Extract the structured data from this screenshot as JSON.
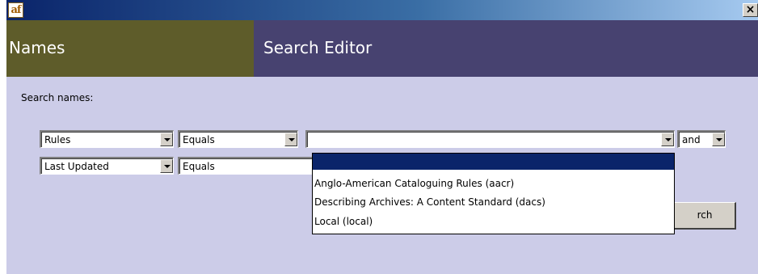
{
  "window": {
    "app_icon_text": "af",
    "close_glyph": "×"
  },
  "header": {
    "left_title": "Names",
    "right_title": "Search Editor"
  },
  "search": {
    "label": "Search names:",
    "rows": [
      {
        "field": "Rules",
        "operator": "Equals",
        "value": "",
        "conjunction": "and"
      },
      {
        "field": "Last Updated",
        "operator": "Equals"
      }
    ],
    "dropdown_options": [
      "",
      "Anglo-American Cataloguing Rules (aacr)",
      "Describing Archives: A Content Standard (dacs)",
      "Local (local)"
    ],
    "button_label": "rch"
  },
  "colors": {
    "background": "#cccce8",
    "header_left": "#5e5c2a",
    "header_right": "#474270",
    "selection": "#0a246a"
  }
}
